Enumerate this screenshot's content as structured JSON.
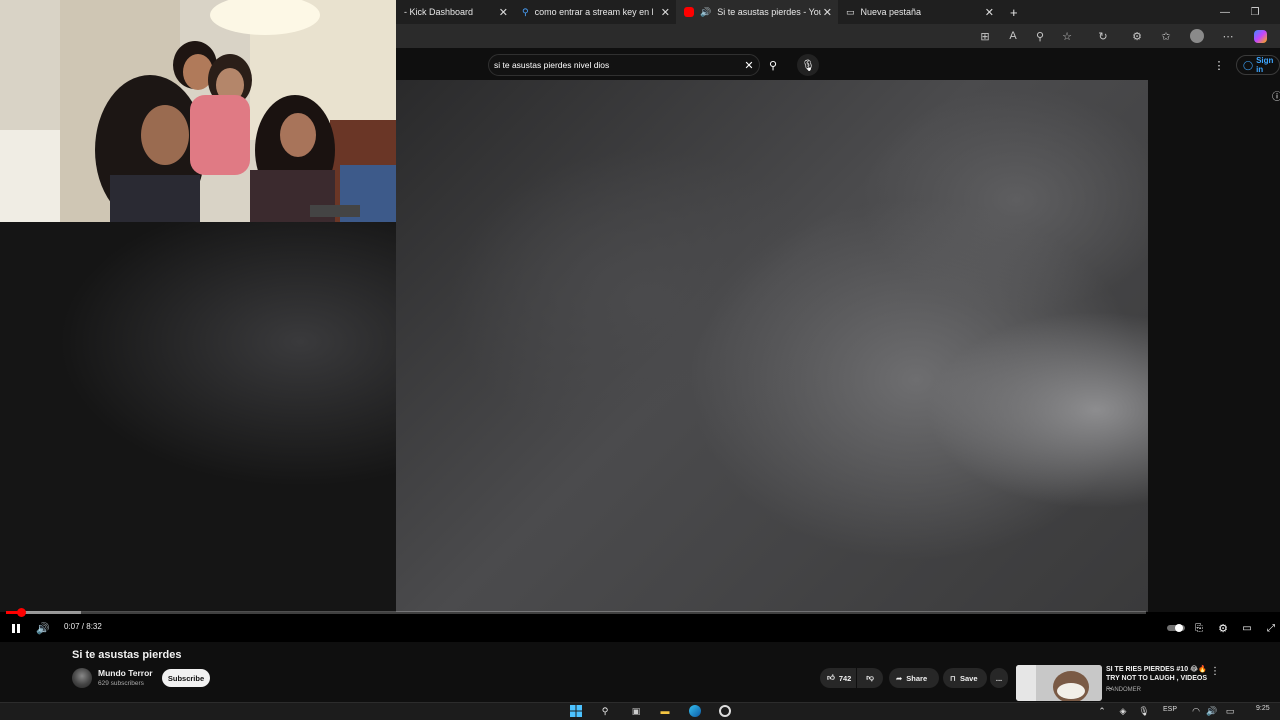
{
  "browser": {
    "tabs": [
      {
        "label": "- Kick Dashboard",
        "active": false
      },
      {
        "label": "como entrar a stream key en kick",
        "active": false
      },
      {
        "label": "Si te asustas pierdes - YouTube",
        "active": true
      },
      {
        "label": "Nueva pestaña",
        "active": false
      }
    ],
    "new_tab_label": "+"
  },
  "youtube": {
    "search": {
      "value": "si te asustas pierdes nivel dios"
    },
    "signin_label": "Sign in"
  },
  "player": {
    "current_time": "0:07",
    "duration": "8:32",
    "time_display": "0:07 / 8:32",
    "progress_fraction": 0.014,
    "buffer_fraction": 0.066
  },
  "video": {
    "title": "Si te asustas pierdes",
    "channel": "Mundo Terror",
    "subscribers": "629 subscribers",
    "subscribe_label": "Subscribe",
    "like_count": "742",
    "share_label": "Share",
    "save_label": "Save",
    "more_label": "..."
  },
  "recommendation": {
    "title": "SI TE RIES PIERDES #10 😂🔥 TRY NOT TO LAUGH , VIDEOS ...",
    "channel": "RANDOMER"
  },
  "taskbar": {
    "language": "ESP",
    "time": "9:25"
  },
  "colors": {
    "accent_red": "#ff0000",
    "link_blue": "#3ea6ff",
    "background": "#0f0f0f"
  }
}
